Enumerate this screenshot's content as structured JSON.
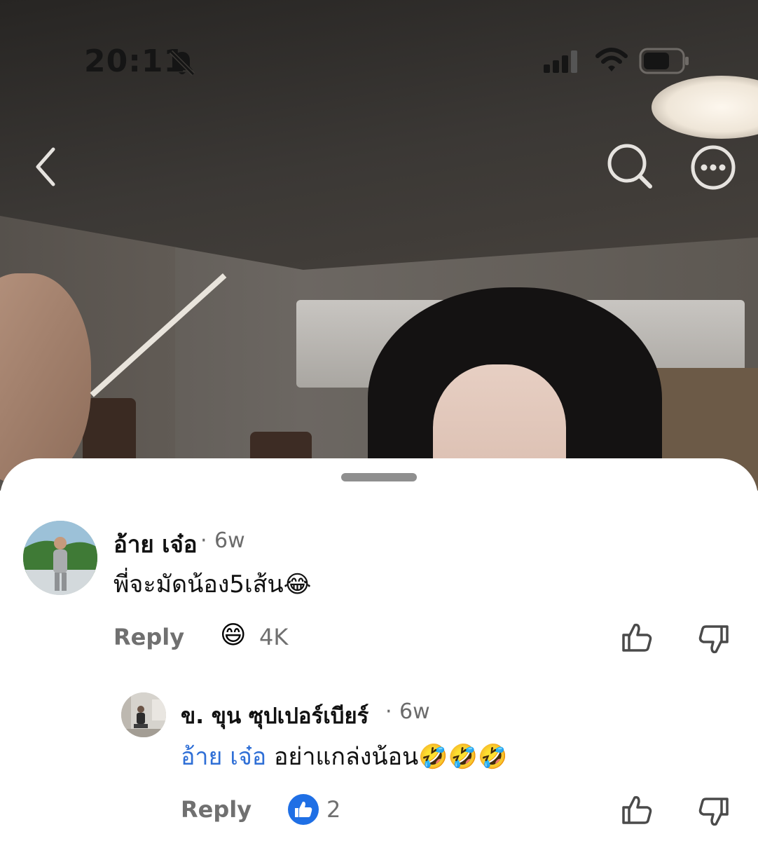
{
  "status_bar": {
    "time": "20:11"
  },
  "icons": {
    "silent": "bell-slash-icon",
    "signal": "cellular-signal-icon",
    "wifi": "wifi-icon",
    "battery": "battery-icon",
    "back": "chevron-left-icon",
    "search": "search-icon",
    "more": "more-horizontal-icon"
  },
  "comments": [
    {
      "author": "อ้าย เจ๋อ",
      "separator": "·",
      "time": "6w",
      "text": "พี่จะมัดน้อง5เส้น😂",
      "reply_label": "Reply",
      "reaction_emoji": "😄",
      "reaction_count": "4K"
    }
  ],
  "replies": [
    {
      "author": "ข. ขุน ซุปเปอร์เบียร์",
      "separator": "·",
      "time": "6w",
      "mention": "อ้าย เจ๋อ",
      "text": " อย่าแกล่งน้อน🤣🤣🤣",
      "reply_label": "Reply",
      "reaction_count": "2"
    }
  ],
  "colors": {
    "mention": "#2f6fd6",
    "like_badge": "#1f6fe5",
    "muted_text": "#707070"
  }
}
